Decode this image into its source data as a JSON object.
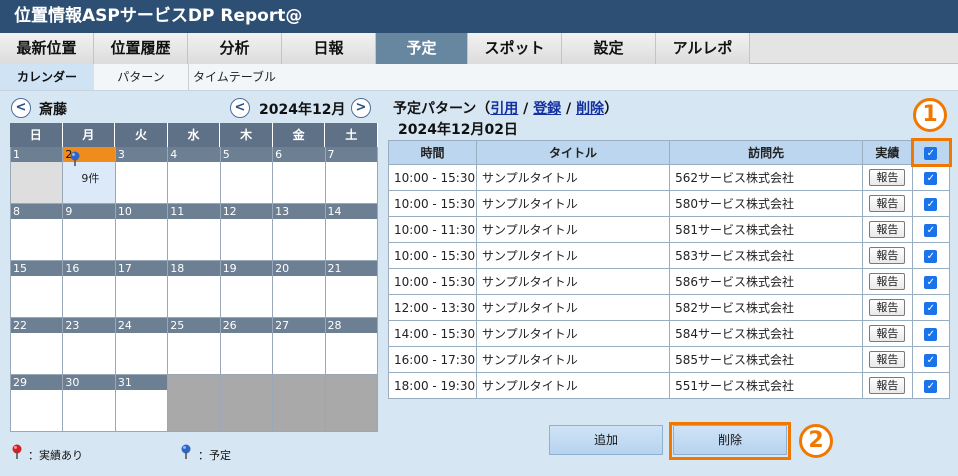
{
  "app": {
    "title": "位置情報ASPサービスDP Report@"
  },
  "main_nav": [
    "最新位置",
    "位置履歴",
    "分析",
    "日報",
    "予定",
    "スポット",
    "設定",
    "アルレポ"
  ],
  "sub_nav": [
    "カレンダー",
    "パターン",
    "タイムテーブル"
  ],
  "user": {
    "name": "斎藤",
    "prev": "<"
  },
  "month": {
    "label": "2024年12月",
    "prev": "<",
    "next": ">"
  },
  "weekdays": [
    "日",
    "月",
    "火",
    "水",
    "木",
    "金",
    "土"
  ],
  "calendar": {
    "days": [
      [
        "1",
        "2",
        "3",
        "4",
        "5",
        "6",
        "7"
      ],
      [
        "8",
        "9",
        "10",
        "11",
        "12",
        "13",
        "14"
      ],
      [
        "15",
        "16",
        "17",
        "18",
        "19",
        "20",
        "21"
      ],
      [
        "22",
        "23",
        "24",
        "25",
        "26",
        "27",
        "28"
      ],
      [
        "29",
        "30",
        "31",
        "",
        "",
        "",
        ""
      ]
    ],
    "event_count": "9件"
  },
  "legend": {
    "actual": "：実績あり",
    "planned": "：予定"
  },
  "pattern": {
    "prefix": "予定パターン（",
    "cite": "引用",
    "sep": " / ",
    "register": "登録",
    "delete": "削除",
    "suffix": "）",
    "date": "2024年12月02日"
  },
  "table": {
    "headers": [
      "時間",
      "タイトル",
      "訪問先",
      "実績"
    ],
    "report_label": "報告",
    "rows": [
      {
        "time": "10:00 - 15:30",
        "title": "サンプルタイトル",
        "place": "562サービス株式会社"
      },
      {
        "time": "10:00 - 15:30",
        "title": "サンプルタイトル",
        "place": "580サービス株式会社"
      },
      {
        "time": "10:00 - 11:30",
        "title": "サンプルタイトル",
        "place": "581サービス株式会社"
      },
      {
        "time": "10:00 - 15:30",
        "title": "サンプルタイトル",
        "place": "583サービス株式会社"
      },
      {
        "time": "10:00 - 15:30",
        "title": "サンプルタイトル",
        "place": "586サービス株式会社"
      },
      {
        "time": "12:00 - 13:30",
        "title": "サンプルタイトル",
        "place": "582サービス株式会社"
      },
      {
        "time": "14:00 - 15:30",
        "title": "サンプルタイトル",
        "place": "584サービス株式会社"
      },
      {
        "time": "16:00 - 17:30",
        "title": "サンプルタイトル",
        "place": "585サービス株式会社"
      },
      {
        "time": "18:00 - 19:30",
        "title": "サンプルタイトル",
        "place": "551サービス株式会社"
      }
    ]
  },
  "actions": {
    "add": "追加",
    "delete": "削除"
  },
  "markers": {
    "one": "1",
    "two": "2"
  }
}
